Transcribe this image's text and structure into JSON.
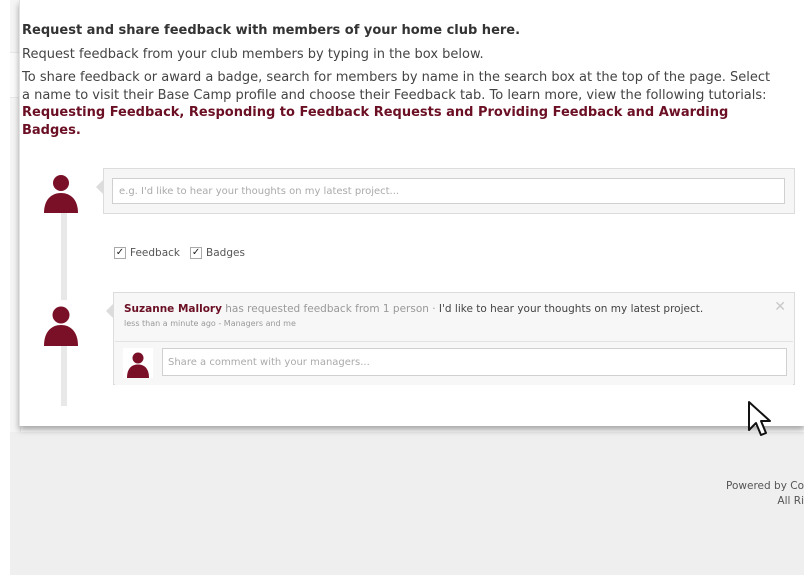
{
  "intro": {
    "heading": "Request and share feedback with members of your home club here.",
    "line1": "Request feedback from your club members by typing in the box below.",
    "line2_pre": "To share feedback or award a badge, search for members by name in the search box at the top of the page. Select a name to visit their Base Camp profile and choose their Feedback tab. To learn more, view the following tutorials: ",
    "links": "Requesting Feedback, Responding to Feedback Requests and Providing Feedback and Awarding Badges."
  },
  "request": {
    "placeholder": "e.g. I'd like to hear your thoughts on my latest project..."
  },
  "filters": {
    "feedback_label": "Feedback",
    "badges_label": "Badges",
    "check_glyph": "✓"
  },
  "feed_item": {
    "author": "Suzanne Mallory",
    "action": " has requested feedback from 1 person · ",
    "message": "I'd like to hear your thoughts on my latest project.",
    "meta": "less than a minute ago - Managers and me",
    "close_glyph": "✕",
    "comment_placeholder": "Share a comment with your managers..."
  },
  "footer": {
    "line1": "Powered by Co",
    "line2": "All Ri"
  },
  "colors": {
    "brand": "#6b0f24",
    "avatar": "#7a1028"
  },
  "icons": {
    "avatar": "person-avatar-icon",
    "close": "close-icon",
    "cursor": "mouse-pointer-icon"
  }
}
